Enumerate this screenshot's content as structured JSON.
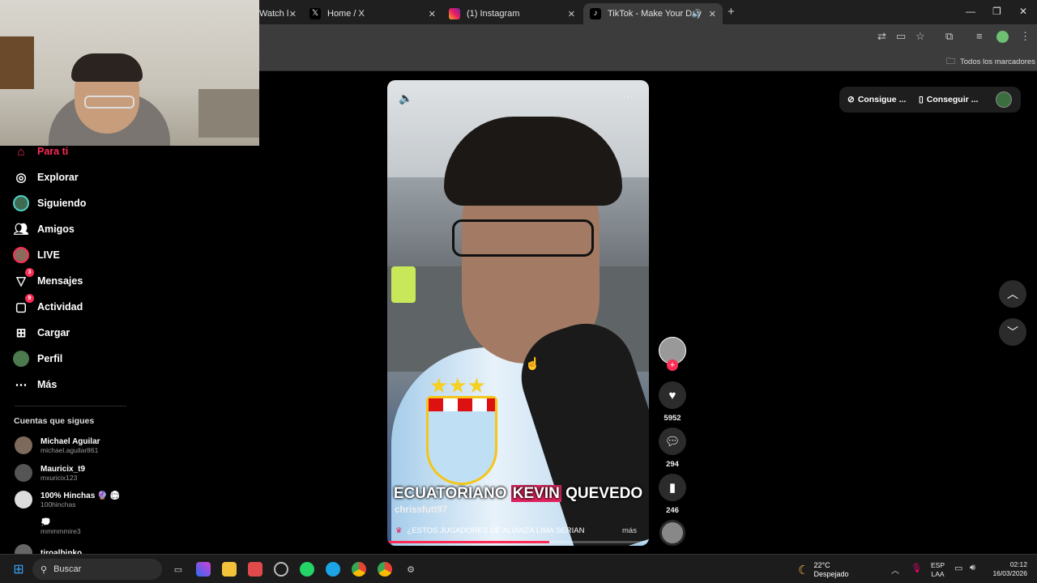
{
  "browser": {
    "tabs": [
      {
        "label": "Watch l",
        "close": "✕"
      },
      {
        "label": "Home / X",
        "close": "✕"
      },
      {
        "label": "(1) Instagram",
        "close": "✕"
      },
      {
        "label": "TikTok - Make Your Day",
        "close": "✕"
      }
    ],
    "new_tab": "+",
    "bookmarks_folder": "Todos los marcadores"
  },
  "sidebar": {
    "items": [
      {
        "label": "Para ti",
        "icon": "home-icon",
        "badge": ""
      },
      {
        "label": "Explorar",
        "icon": "compass-icon",
        "badge": ""
      },
      {
        "label": "Siguiendo",
        "icon": "following-avatar-icon",
        "badge": ""
      },
      {
        "label": "Amigos",
        "icon": "friends-icon",
        "badge": ""
      },
      {
        "label": "LIVE",
        "icon": "live-icon",
        "badge": ""
      },
      {
        "label": "Mensajes",
        "icon": "messages-icon",
        "badge": "3"
      },
      {
        "label": "Actividad",
        "icon": "activity-icon",
        "badge": "9"
      },
      {
        "label": "Cargar",
        "icon": "upload-icon",
        "badge": ""
      },
      {
        "label": "Perfil",
        "icon": "profile-icon",
        "badge": ""
      },
      {
        "label": "Más",
        "icon": "more-icon",
        "badge": ""
      }
    ],
    "following_title": "Cuentas que sigues",
    "accounts": [
      {
        "name": "Michael Aguilar",
        "handle": "michael.aguilar861"
      },
      {
        "name": "Mauricix_t9",
        "handle": "mxuricix123"
      },
      {
        "name": "100% Hinchas 🔮 🏟",
        "handle": "100hinchas"
      },
      {
        "name": "💭",
        "handle": "mmmmmire3"
      },
      {
        "name": "tiroalbinko",
        "handle": ""
      }
    ]
  },
  "header_actions": {
    "get_coins": "Consigue ...",
    "get_app": "Conseguir ..."
  },
  "video": {
    "caption_overlay_pre": "ECUATORIANO ",
    "caption_overlay_highlight": "KEVIN",
    "caption_overlay_post": " QUEVEDO",
    "author": "chrissfutt97",
    "description": "¿ESTOS JUGADORES DE ALIANZA LIMA SERIAN",
    "more": "más",
    "progress": 0.62
  },
  "actions": {
    "likes": "5952",
    "comments": "294",
    "saves": "246"
  },
  "taskbar": {
    "search": "Buscar",
    "weather_temp": "22°C",
    "weather_desc": "Despejado",
    "lang_top": "ESP",
    "lang_bottom": "LAA",
    "time": "02:12",
    "date": "16/03/2026"
  },
  "colors": {
    "accent": "#fe2c55",
    "highlight": "#e0245e"
  }
}
